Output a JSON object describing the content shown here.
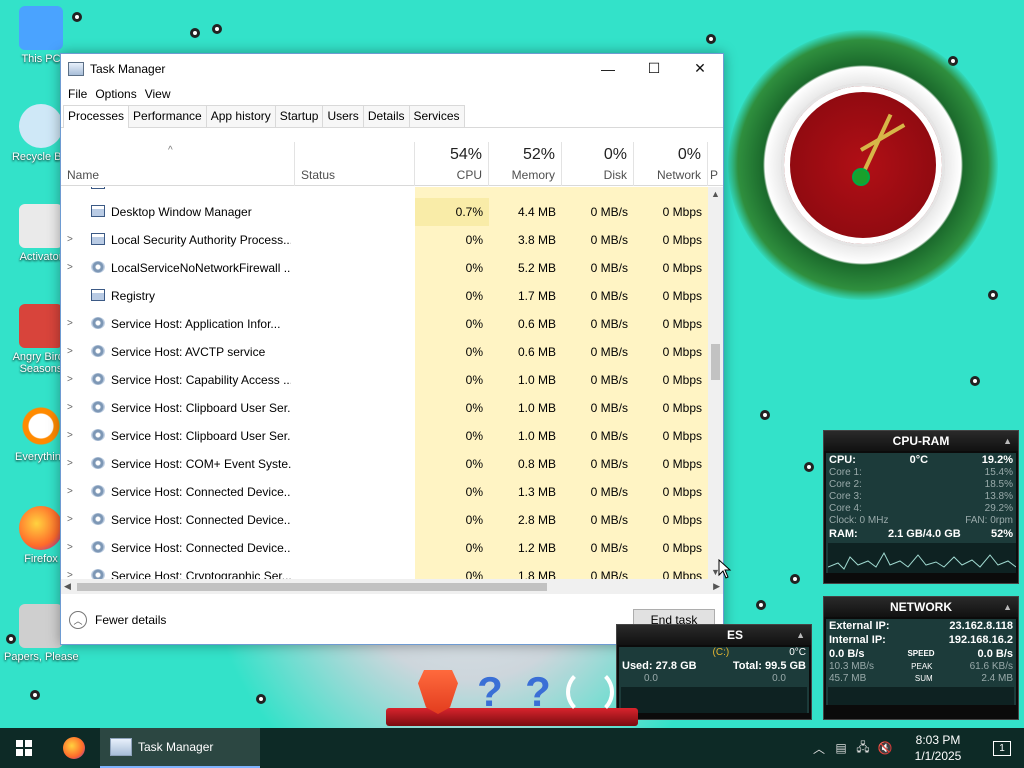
{
  "desktop": {
    "icons": [
      {
        "label": "This PC",
        "color": "#4aa3ff"
      },
      {
        "label": "Recycle Bin",
        "color": "#cfe8f7"
      },
      {
        "label": "Activator",
        "color": "#eaeaea"
      },
      {
        "label": "Angry Birds Seasons",
        "color": "#d8443b"
      },
      {
        "label": "Everything",
        "color": "#ff8a00"
      },
      {
        "label": "Firefox",
        "color": "#ff6a2a"
      },
      {
        "label": "Papers, Please",
        "color": "#cfcfcf"
      }
    ]
  },
  "task_manager": {
    "title": "Task Manager",
    "controls": {
      "minimize": "—",
      "maximize": "☐",
      "close": "✕"
    },
    "menu": [
      "File",
      "Options",
      "View"
    ],
    "tabs": [
      "Processes",
      "Performance",
      "App history",
      "Startup",
      "Users",
      "Details",
      "Services"
    ],
    "active_tab": "Processes",
    "columns": {
      "name": "Name",
      "status": "Status",
      "cpu": {
        "percent": "54%",
        "label": "CPU"
      },
      "memory": {
        "percent": "52%",
        "label": "Memory"
      },
      "disk": {
        "percent": "0%",
        "label": "Disk"
      },
      "network": {
        "percent": "0%",
        "label": "Network"
      },
      "power": "P"
    },
    "sort_indicator": "^",
    "rows": [
      {
        "expand": "",
        "icon": "window-icon",
        "name": "Desktop Window Manager",
        "cpu": "0.7%",
        "memory": "4.4 MB",
        "disk": "0 MB/s",
        "network": "0 Mbps",
        "highlight": true
      },
      {
        "expand": ">",
        "icon": "window-icon",
        "name": "Local Security Authority Process...",
        "cpu": "0%",
        "memory": "3.8 MB",
        "disk": "0 MB/s",
        "network": "0 Mbps"
      },
      {
        "expand": ">",
        "icon": "gear-icon",
        "name": "LocalServiceNoNetworkFirewall ...",
        "cpu": "0%",
        "memory": "5.2 MB",
        "disk": "0 MB/s",
        "network": "0 Mbps"
      },
      {
        "expand": "",
        "icon": "window-icon",
        "name": "Registry",
        "cpu": "0%",
        "memory": "1.7 MB",
        "disk": "0 MB/s",
        "network": "0 Mbps"
      },
      {
        "expand": ">",
        "icon": "gear-icon",
        "name": "Service Host: Application Infor...",
        "cpu": "0%",
        "memory": "0.6 MB",
        "disk": "0 MB/s",
        "network": "0 Mbps"
      },
      {
        "expand": ">",
        "icon": "gear-icon",
        "name": "Service Host: AVCTP service",
        "cpu": "0%",
        "memory": "0.6 MB",
        "disk": "0 MB/s",
        "network": "0 Mbps"
      },
      {
        "expand": ">",
        "icon": "gear-icon",
        "name": "Service Host: Capability Access ...",
        "cpu": "0%",
        "memory": "1.0 MB",
        "disk": "0 MB/s",
        "network": "0 Mbps"
      },
      {
        "expand": ">",
        "icon": "gear-icon",
        "name": "Service Host: Clipboard User Ser...",
        "cpu": "0%",
        "memory": "1.0 MB",
        "disk": "0 MB/s",
        "network": "0 Mbps"
      },
      {
        "expand": ">",
        "icon": "gear-icon",
        "name": "Service Host: Clipboard User Ser...",
        "cpu": "0%",
        "memory": "1.0 MB",
        "disk": "0 MB/s",
        "network": "0 Mbps"
      },
      {
        "expand": ">",
        "icon": "gear-icon",
        "name": "Service Host: COM+ Event Syste...",
        "cpu": "0%",
        "memory": "0.8 MB",
        "disk": "0 MB/s",
        "network": "0 Mbps"
      },
      {
        "expand": ">",
        "icon": "gear-icon",
        "name": "Service Host: Connected Device...",
        "cpu": "0%",
        "memory": "1.3 MB",
        "disk": "0 MB/s",
        "network": "0 Mbps"
      },
      {
        "expand": ">",
        "icon": "gear-icon",
        "name": "Service Host: Connected Device...",
        "cpu": "0%",
        "memory": "2.8 MB",
        "disk": "0 MB/s",
        "network": "0 Mbps"
      },
      {
        "expand": ">",
        "icon": "gear-icon",
        "name": "Service Host: Connected Device...",
        "cpu": "0%",
        "memory": "1.2 MB",
        "disk": "0 MB/s",
        "network": "0 Mbps"
      },
      {
        "expand": ">",
        "icon": "gear-icon",
        "name": "Service Host: Cryptographic Ser...",
        "cpu": "0%",
        "memory": "1.8 MB",
        "disk": "0 MB/s",
        "network": "0 Mbps"
      }
    ],
    "fewer_details": "Fewer details",
    "end_task": "End task"
  },
  "cpu_ram_gadget": {
    "title": "CPU-RAM",
    "cpu_label": "CPU:",
    "cpu_temp": "0°C",
    "cpu_total": "19.2%",
    "cores": [
      {
        "label": "Core 1:",
        "value": "15.4%"
      },
      {
        "label": "Core 2:",
        "value": "18.5%"
      },
      {
        "label": "Core 3:",
        "value": "13.8%"
      },
      {
        "label": "Core 4:",
        "value": "29.2%"
      }
    ],
    "clock": "Clock: 0 MHz",
    "fan": "FAN: 0rpm",
    "ram_label": "RAM:",
    "ram_value": "2.1 GB/4.0 GB",
    "ram_pct": "52%"
  },
  "network_gadget": {
    "title": "NETWORK",
    "external_ip_label": "External IP:",
    "external_ip": "23.162.8.118",
    "internal_ip_label": "Internal IP:",
    "internal_ip": "192.168.16.2",
    "speed_left": "0.0 B/s",
    "speed_label": "SPEED",
    "speed_right": "0.0 B/s",
    "peak_left": "10.3 MB/s",
    "peak_label": "PEAK",
    "peak_right": "61.6 KB/s",
    "sum_left": "45.7 MB",
    "sum_label": "SUM",
    "sum_right": "2.4 MB"
  },
  "drives_gadget": {
    "title": "ES",
    "temp": "0°C",
    "drive": "(C:)",
    "used": "Used: 27.8 GB",
    "total": "Total: 99.5 GB",
    "read": "0.0",
    "write": "0.0"
  },
  "taskbar": {
    "active_app": "Task Manager",
    "time": "8:03 PM",
    "date": "1/1/2025",
    "notification_count": "1"
  }
}
